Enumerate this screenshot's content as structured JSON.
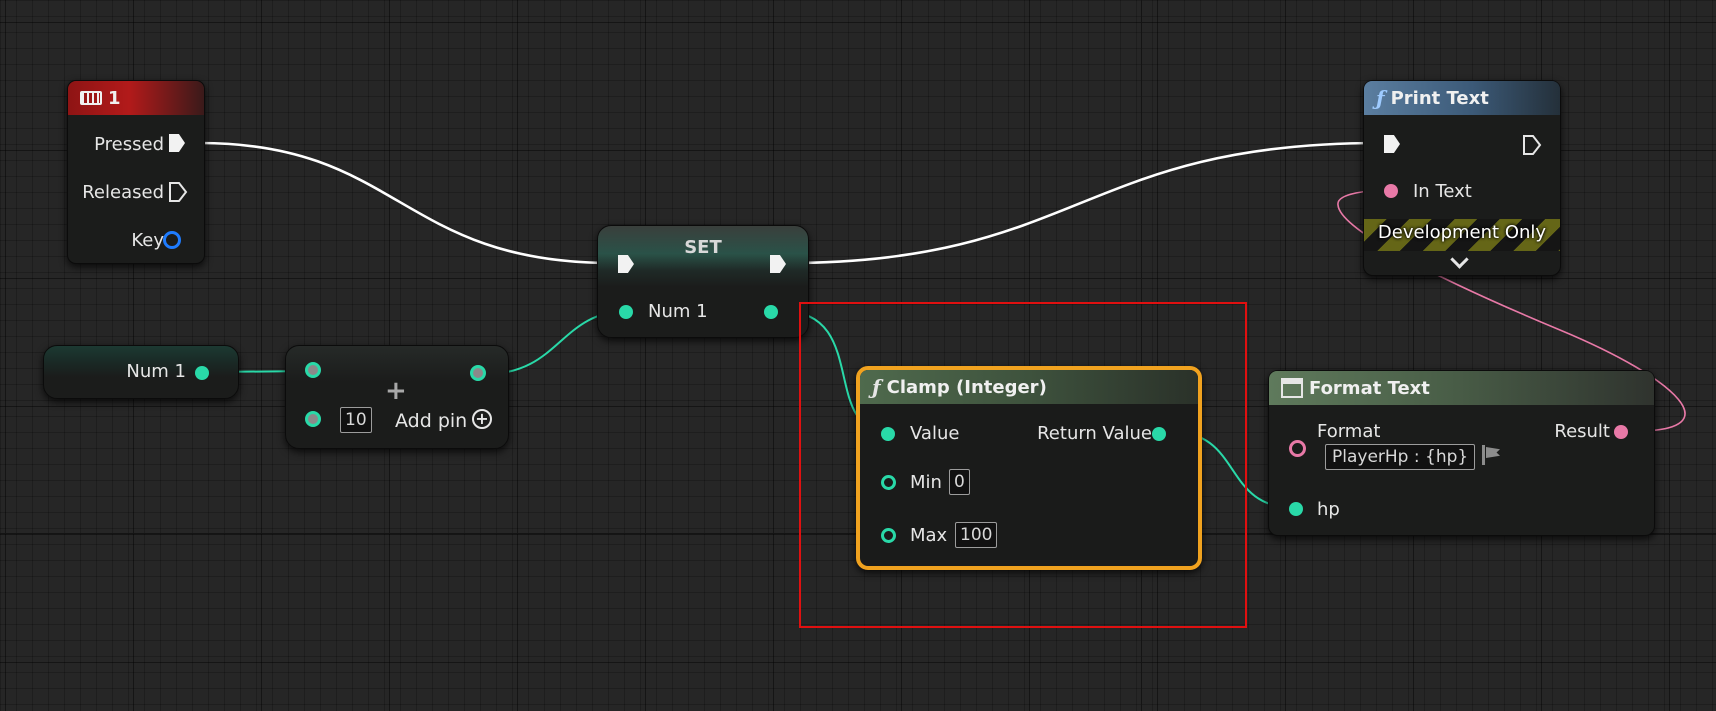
{
  "key_node": {
    "title": "1",
    "pins": [
      "Pressed",
      "Released",
      "Key"
    ]
  },
  "var_get": {
    "label": "Num 1"
  },
  "add_node": {
    "value": "10",
    "add_pin": "Add pin"
  },
  "set_node": {
    "title": "SET",
    "pin": "Num 1"
  },
  "clamp_node": {
    "title": "Clamp (Integer)",
    "value": "Value",
    "return_value": "Return Value",
    "min_label": "Min",
    "min_value": "0",
    "max_label": "Max",
    "max_value": "100"
  },
  "print_node": {
    "title": "Print Text",
    "in_text": "In Text",
    "dev_only": "Development Only"
  },
  "format_node": {
    "title": "Format Text",
    "format": "Format",
    "format_value": "PlayerHp : {hp}",
    "result": "Result",
    "hp": "hp"
  },
  "colors": {
    "exec": "#f2f2f2",
    "integer": "#29d9a8",
    "text": "#e879a7",
    "struct": "#1f7cff",
    "selection": "#f0a21f",
    "highlight": "#e01010"
  }
}
